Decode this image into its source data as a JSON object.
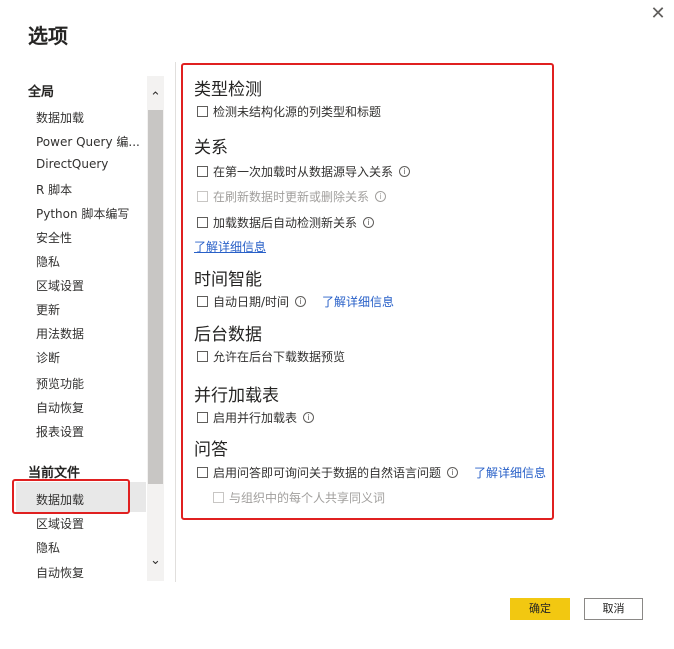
{
  "dialog": {
    "title": "选项",
    "close_glyph": "✕"
  },
  "sidebar": {
    "global_heading": "全局",
    "global_items": [
      "数据加载",
      "Power Query 编...",
      "DirectQuery",
      "R 脚本",
      "Python 脚本编写",
      "安全性",
      "隐私",
      "区域设置",
      "更新",
      "用法数据",
      "诊断",
      "预览功能",
      "自动恢复",
      "报表设置"
    ],
    "current_heading": "当前文件",
    "current_items": [
      "数据加载",
      "区域设置",
      "隐私",
      "自动恢复"
    ],
    "selected_item": "数据加载",
    "scroll_up_glyph": "⌃",
    "scroll_down_glyph": "⌄"
  },
  "main": {
    "type_detection": {
      "title": "类型检测",
      "detect_types": {
        "label": "检测未结构化源的列类型和标题",
        "checked": false
      }
    },
    "relationships": {
      "title": "关系",
      "import_relationships": {
        "label": "在第一次加载时从数据源导入关系",
        "checked": false
      },
      "update_relationships": {
        "label": "在刷新数据时更新或删除关系",
        "checked": false,
        "disabled": true
      },
      "autodetect_relationships": {
        "label": "加载数据后自动检测新关系",
        "checked": false
      },
      "learn_more": "了解详细信息"
    },
    "time_intelligence": {
      "title": "时间智能",
      "auto_datetime": {
        "label": "自动日期/时间",
        "checked": false
      },
      "learn_more": "了解详细信息"
    },
    "background_data": {
      "title": "后台数据",
      "background_preview": {
        "label": "允许在后台下载数据预览",
        "checked": false
      }
    },
    "parallel_loading": {
      "title": "并行加载表",
      "enable_parallel": {
        "label": "启用并行加载表",
        "checked": false
      }
    },
    "qna": {
      "title": "问答",
      "enable_qna": {
        "label": "启用问答即可询问关于数据的自然语言问题",
        "checked": false
      },
      "learn_more": "了解详细信息",
      "share_synonyms": {
        "label": "与组织中的每个人共享同义词",
        "checked": false,
        "disabled": true
      }
    },
    "info_glyph": "i"
  },
  "footer": {
    "ok_label": "确定",
    "cancel_label": "取消"
  },
  "colors": {
    "accent_yellow": "#f2c811",
    "link_blue": "#2860c8",
    "highlight_red": "#e02020"
  }
}
